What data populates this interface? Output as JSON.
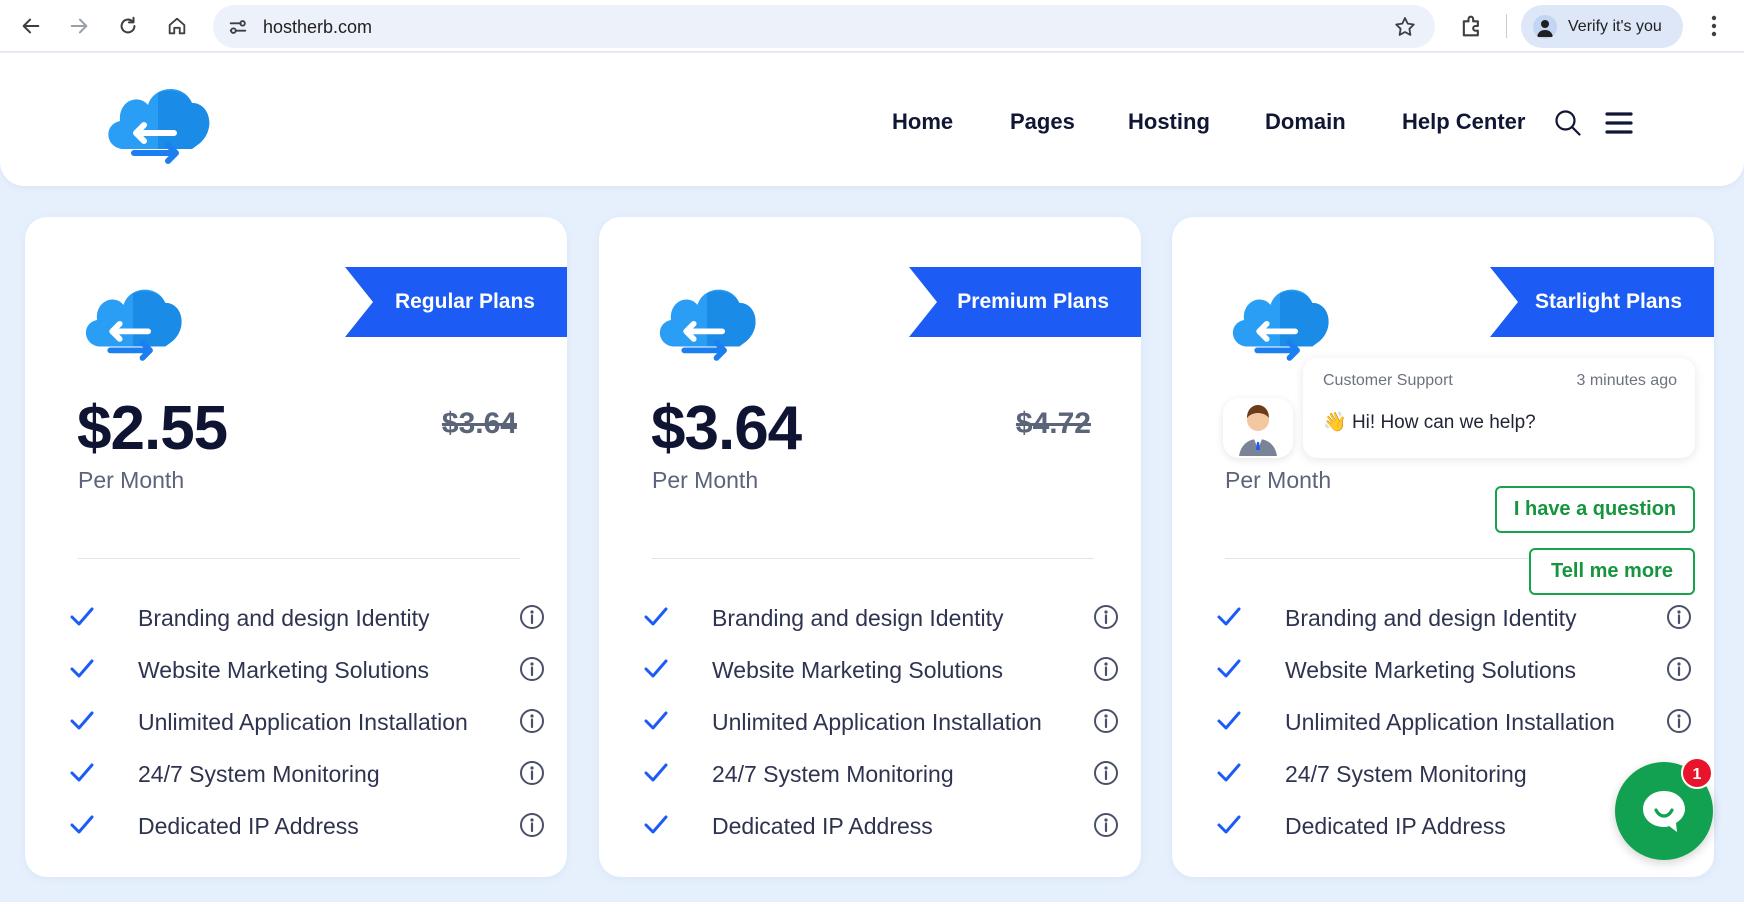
{
  "browser": {
    "url": "hostherb.com",
    "profile_chip_label": "Verify it's you",
    "icons": [
      "back-icon",
      "forward-icon",
      "reload-icon",
      "home-icon",
      "site-settings-icon",
      "bookmark-star-icon",
      "extensions-icon",
      "menu-kebab-icon"
    ]
  },
  "header": {
    "nav": [
      "Home",
      "Pages",
      "Hosting",
      "Domain",
      "Help Center"
    ],
    "icons": [
      "search-icon",
      "hamburger-menu-icon"
    ]
  },
  "colors": {
    "accent_blue": "#1c5cf5",
    "logo_blue": "#2196f3",
    "chat_green": "#12a150",
    "badge_red": "#e8142b",
    "background": "#e6f0fd"
  },
  "plans": [
    {
      "ribbon": "Regular Plans",
      "price": "$2.55",
      "old_price": "$3.64",
      "period": "Per Month",
      "features": [
        "Branding and design Identity",
        "Website Marketing Solutions",
        "Unlimited Application Installation",
        "24/7 System Monitoring",
        "Dedicated IP Address"
      ]
    },
    {
      "ribbon": "Premium Plans",
      "price": "$3.64",
      "old_price": "$4.72",
      "period": "Per Month",
      "features": [
        "Branding and design Identity",
        "Website Marketing Solutions",
        "Unlimited Application Installation",
        "24/7 System Monitoring",
        "Dedicated IP Address"
      ]
    },
    {
      "ribbon": "Starlight Plans",
      "period": "Per Month",
      "features": [
        "Branding and design Identity",
        "Website Marketing Solutions",
        "Unlimited Application Installation",
        "24/7 System Monitoring",
        "Dedicated IP Address"
      ]
    }
  ],
  "chat": {
    "sender": "Customer Support",
    "time": "3 minutes ago",
    "emoji": "👋",
    "message": "Hi! How can we help?",
    "options": [
      "I have a question",
      "Tell me more"
    ],
    "unread_count": "1"
  }
}
